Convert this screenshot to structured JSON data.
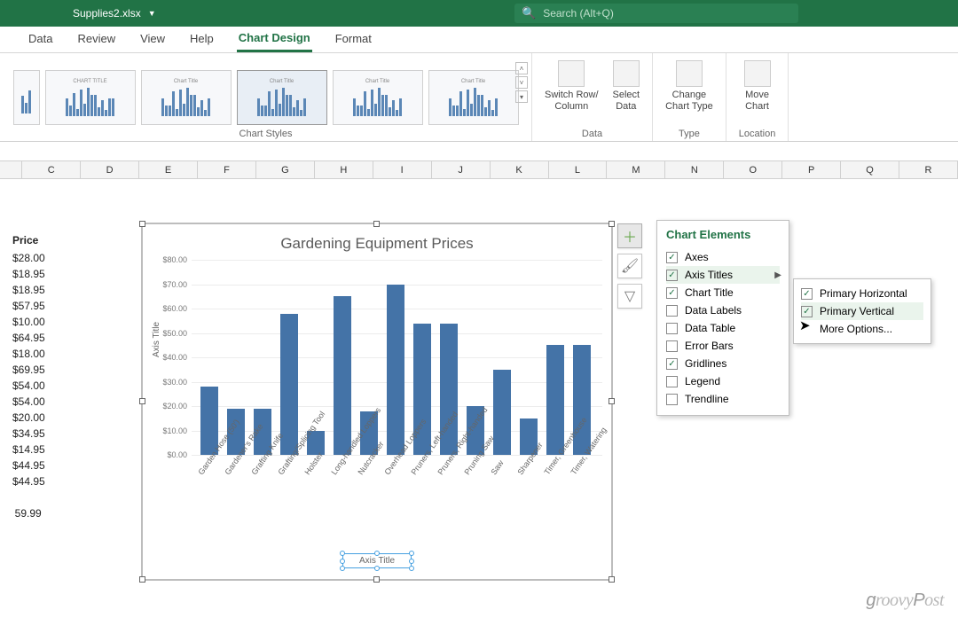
{
  "titlebar": {
    "filename": "Supplies2.xlsx"
  },
  "search": {
    "placeholder": "Search (Alt+Q)"
  },
  "tabs": [
    "Data",
    "Review",
    "View",
    "Help",
    "Chart Design",
    "Format"
  ],
  "active_tab": "Chart Design",
  "ribbon": {
    "styles_label": "Chart Styles",
    "data_group": {
      "label": "Data",
      "switch": "Switch Row/\nColumn",
      "select": "Select\nData"
    },
    "type_group": {
      "label": "Type",
      "change": "Change\nChart Type"
    },
    "location_group": {
      "label": "Location",
      "move": "Move\nChart"
    }
  },
  "columns": [
    "",
    "C",
    "D",
    "E",
    "F",
    "G",
    "H",
    "I",
    "J",
    "K",
    "L",
    "M",
    "N",
    "O",
    "P",
    "Q",
    "R"
  ],
  "prices": {
    "header": "Price",
    "values": [
      "$28.00",
      "$18.95",
      "$18.95",
      "$57.95",
      "$10.00",
      "$64.95",
      "$18.00",
      "$69.95",
      "$54.00",
      "$54.00",
      "$20.00",
      "$34.95",
      "$14.95",
      "$44.95",
      "$44.95",
      "",
      "59.99"
    ]
  },
  "chart_data": {
    "type": "bar",
    "title": "Gardening Equipment Prices",
    "y_axis_title": "Axis Title",
    "x_axis_title": "Axis Title",
    "ylim": [
      0,
      80
    ],
    "yticks": [
      "$0.00",
      "$10.00",
      "$20.00",
      "$30.00",
      "$40.00",
      "$50.00",
      "$60.00",
      "$70.00",
      "$80.00"
    ],
    "categories": [
      "Garden Hose (50')",
      "Gardener's Rake",
      "Grafting Knife",
      "Grafting/Splicing Tool",
      "Holster",
      "Long-handled Loppers",
      "Nutcracker",
      "Overhead Loppers",
      "Pruners, Left-handed",
      "Pruners, Right-handed",
      "Pruning Saw",
      "Saw",
      "Sharpener",
      "Timer, Greenhouse",
      "Timer, Watering"
    ],
    "values": [
      28,
      18.95,
      18.95,
      57.95,
      10,
      64.95,
      18,
      69.95,
      54,
      54,
      20,
      34.95,
      14.95,
      44.95,
      44.95
    ]
  },
  "chart_elements": {
    "title": "Chart Elements",
    "items": [
      {
        "label": "Axes",
        "checked": true
      },
      {
        "label": "Axis Titles",
        "checked": true,
        "arrow": true
      },
      {
        "label": "Chart Title",
        "checked": true
      },
      {
        "label": "Data Labels",
        "checked": false
      },
      {
        "label": "Data Table",
        "checked": false
      },
      {
        "label": "Error Bars",
        "checked": false
      },
      {
        "label": "Gridlines",
        "checked": true
      },
      {
        "label": "Legend",
        "checked": false
      },
      {
        "label": "Trendline",
        "checked": false
      }
    ]
  },
  "axis_titles_sub": {
    "items": [
      {
        "label": "Primary Horizontal",
        "checked": true
      },
      {
        "label": "Primary Vertical",
        "checked": true,
        "highlight": true
      },
      {
        "label": "More Options...",
        "checked": null
      }
    ]
  },
  "watermark": "groovyPost"
}
